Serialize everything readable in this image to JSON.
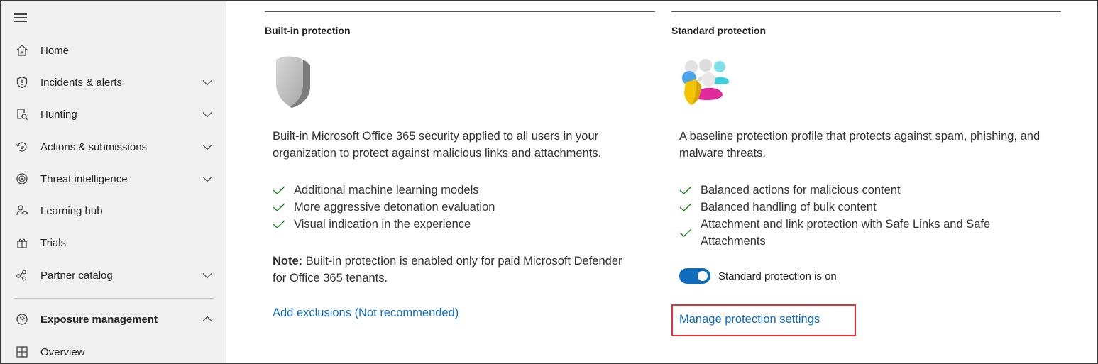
{
  "sidebar": {
    "items": [
      {
        "label": "Home",
        "icon": "home-icon",
        "chevron": "none"
      },
      {
        "label": "Incidents & alerts",
        "icon": "shield-alert-icon",
        "chevron": "down"
      },
      {
        "label": "Hunting",
        "icon": "hunting-icon",
        "chevron": "down"
      },
      {
        "label": "Actions & submissions",
        "icon": "actions-icon",
        "chevron": "down"
      },
      {
        "label": "Threat intelligence",
        "icon": "threat-intel-icon",
        "chevron": "down"
      },
      {
        "label": "Learning hub",
        "icon": "learning-hub-icon",
        "chevron": "none"
      },
      {
        "label": "Trials",
        "icon": "trials-icon",
        "chevron": "none"
      },
      {
        "label": "Partner catalog",
        "icon": "partner-catalog-icon",
        "chevron": "down"
      },
      {
        "label": "Exposure management",
        "icon": "exposure-management-icon",
        "chevron": "up"
      },
      {
        "label": "Overview",
        "icon": "overview-icon",
        "chevron": "none"
      }
    ]
  },
  "builtin": {
    "title": "Built-in protection",
    "description": "Built-in Microsoft Office 365 security applied to all users in your organization to protect against malicious links and attachments.",
    "checks": [
      "Additional machine learning models",
      "More aggressive detonation evaluation",
      "Visual indication in the experience"
    ],
    "note_label": "Note:",
    "note_text": "Built-in protection is enabled only for paid Microsoft Defender for Office 365 tenants.",
    "link": "Add exclusions (Not recommended)"
  },
  "standard": {
    "title": "Standard protection",
    "description": "A baseline protection profile that protects against spam, phishing, and malware threats.",
    "checks": [
      "Balanced actions for malicious content",
      "Balanced handling of bulk content",
      "Attachment and link protection with Safe Links and Safe Attachments"
    ],
    "toggle_label": "Standard protection is on",
    "toggle_on": true,
    "link": "Manage protection settings"
  },
  "colors": {
    "accent": "#0f6cbd",
    "check": "#107c10",
    "highlight": "#e0343a",
    "sidebar_bg": "#f0f0f0"
  }
}
